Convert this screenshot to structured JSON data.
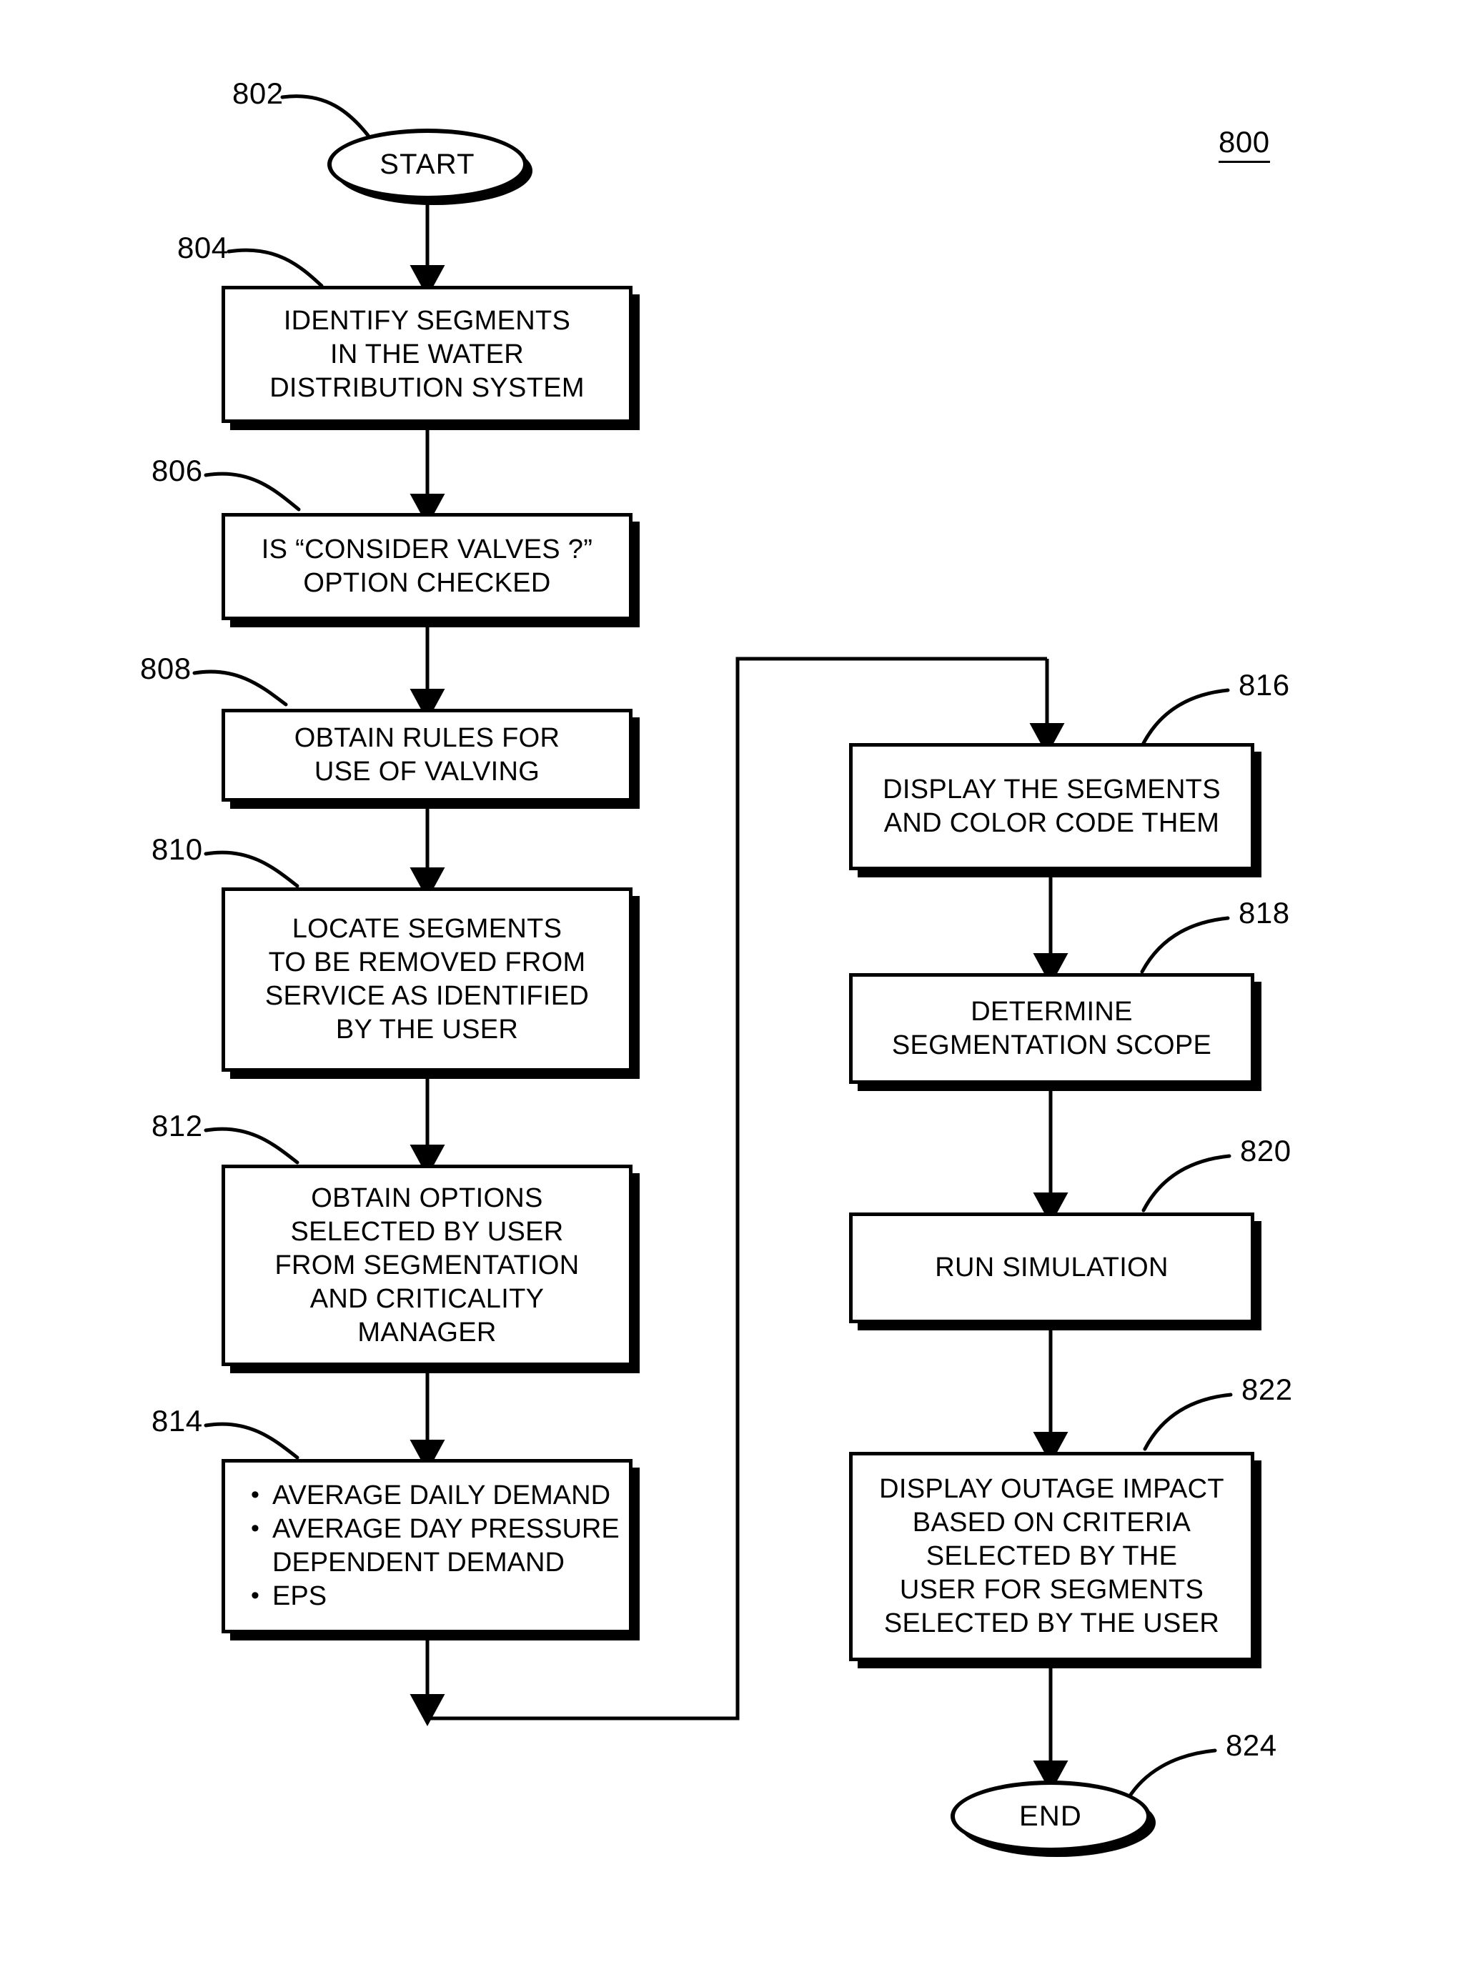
{
  "figure": {
    "label": "800",
    "type": "flowchart",
    "title_text": ""
  },
  "nodes": [
    {
      "id": "start",
      "ref": "802",
      "shape": "terminator",
      "text": "START"
    },
    {
      "id": "identify-segments",
      "ref": "804",
      "shape": "process",
      "text": "IDENTIFY SEGMENTS\nIN THE WATER\nDISTRIBUTION SYSTEM"
    },
    {
      "id": "consider-valves",
      "ref": "806",
      "shape": "process",
      "text": "IS “CONSIDER VALVES ?”\nOPTION CHECKED"
    },
    {
      "id": "obtain-rules",
      "ref": "808",
      "shape": "process",
      "text": "OBTAIN RULES FOR\nUSE OF VALVING"
    },
    {
      "id": "locate-segments",
      "ref": "810",
      "shape": "process",
      "text": "LOCATE SEGMENTS\nTO BE REMOVED FROM\nSERVICE AS IDENTIFIED\nBY THE USER"
    },
    {
      "id": "obtain-options",
      "ref": "812",
      "shape": "process",
      "text": "OBTAIN OPTIONS\nSELECTED BY USER\nFROM SEGMENTATION\nAND CRITICALITY\nMANAGER"
    },
    {
      "id": "demand-options",
      "ref": "814",
      "shape": "process-bullets",
      "bullets": [
        "AVERAGE DAILY DEMAND",
        "AVERAGE DAY PRESSURE\nDEPENDENT DEMAND",
        "EPS"
      ]
    },
    {
      "id": "display-segments",
      "ref": "816",
      "shape": "process",
      "text": "DISPLAY THE SEGMENTS\nAND COLOR CODE THEM"
    },
    {
      "id": "determine-scope",
      "ref": "818",
      "shape": "process",
      "text": "DETERMINE\nSEGMENTATION SCOPE"
    },
    {
      "id": "run-simulation",
      "ref": "820",
      "shape": "process",
      "text": "RUN SIMULATION"
    },
    {
      "id": "display-outage",
      "ref": "822",
      "shape": "process",
      "text": "DISPLAY OUTAGE IMPACT\nBASED ON CRITERIA\nSELECTED BY THE\nUSER FOR SEGMENTS\nSELECTED BY THE USER"
    },
    {
      "id": "end",
      "ref": "824",
      "shape": "terminator",
      "text": "END"
    }
  ],
  "refs": {
    "n802": "802",
    "n804": "804",
    "n806": "806",
    "n808": "808",
    "n810": "810",
    "n812": "812",
    "n814": "814",
    "n816": "816",
    "n818": "818",
    "n820": "820",
    "n822": "822",
    "n824": "824",
    "n800": "800"
  },
  "bullets_814": {
    "b0": "AVERAGE DAILY DEMAND",
    "b1": "AVERAGE DAY PRESSURE\nDEPENDENT DEMAND",
    "b2": "EPS"
  },
  "text": {
    "start": "START",
    "identify_segments": "IDENTIFY SEGMENTS\nIN THE WATER\nDISTRIBUTION SYSTEM",
    "consider_valves": "IS “CONSIDER VALVES ?”\nOPTION CHECKED",
    "obtain_rules": "OBTAIN RULES FOR\nUSE OF VALVING",
    "locate_segments": "LOCATE SEGMENTS\nTO BE REMOVED FROM\nSERVICE AS IDENTIFIED\nBY THE USER",
    "obtain_options": "OBTAIN OPTIONS\nSELECTED BY USER\nFROM SEGMENTATION\nAND CRITICALITY\nMANAGER",
    "display_segments": "DISPLAY THE SEGMENTS\nAND COLOR CODE THEM",
    "determine_scope": "DETERMINE\nSEGMENTATION SCOPE",
    "run_simulation": "RUN SIMULATION",
    "display_outage": "DISPLAY OUTAGE IMPACT\nBASED ON CRITERIA\nSELECTED BY THE\nUSER FOR SEGMENTS\nSELECTED BY THE USER",
    "end": "END"
  },
  "colors": {
    "ink": "#000000",
    "paper": "#ffffff"
  }
}
